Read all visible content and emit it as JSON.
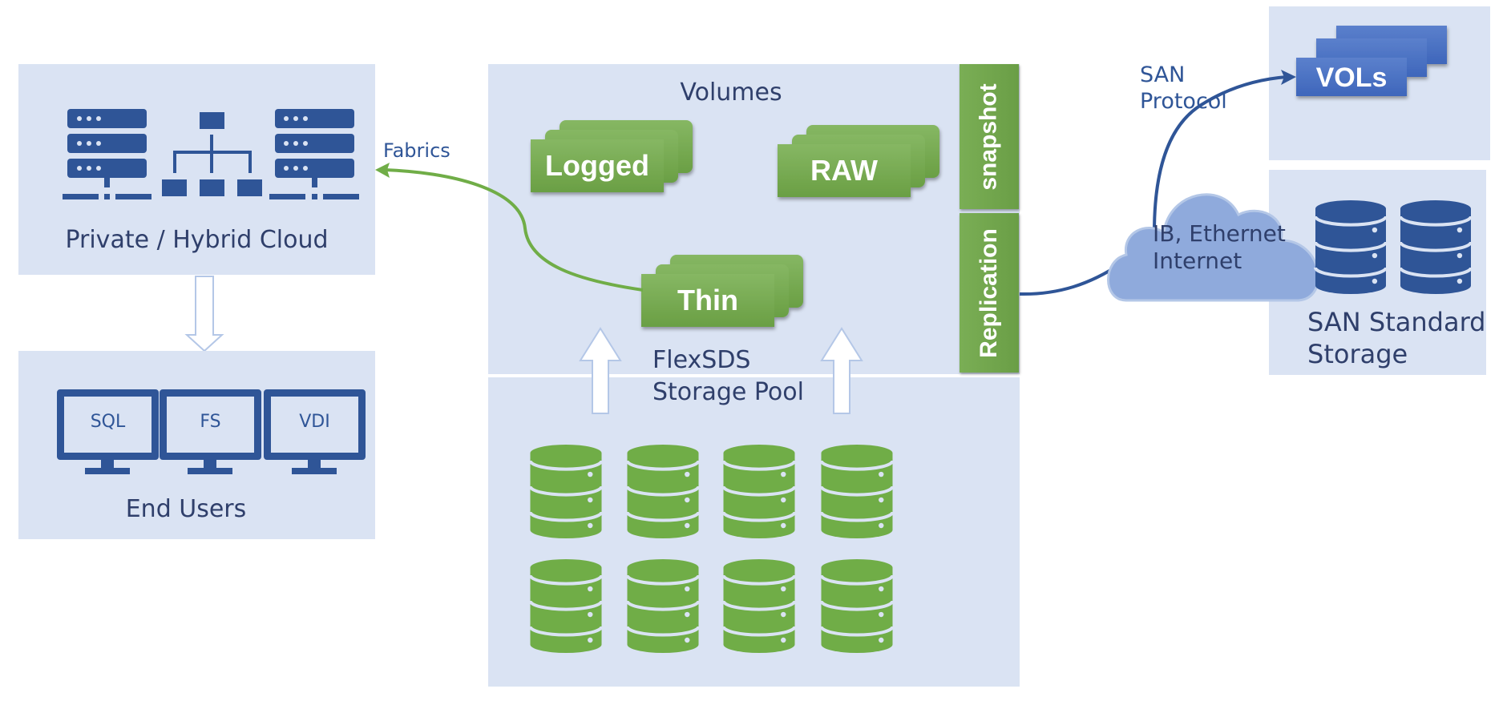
{
  "private_cloud": {
    "label": "Private / Hybrid Cloud",
    "icons": [
      "server-rack-icon",
      "network-topology-icon",
      "server-rack-icon"
    ]
  },
  "end_users": {
    "label": "End Users",
    "monitors": [
      {
        "label": "SQL"
      },
      {
        "label": "FS"
      },
      {
        "label": "VDI"
      }
    ]
  },
  "fabrics": {
    "label": "Fabrics"
  },
  "volumes": {
    "title": "Volumes",
    "types": [
      {
        "label": "Logged"
      },
      {
        "label": "RAW"
      },
      {
        "label": "Thin"
      }
    ],
    "services": [
      {
        "label": "snapshot"
      },
      {
        "label": "Replication"
      }
    ]
  },
  "storage_pool": {
    "line1": "FlexSDS",
    "line2": "Storage Pool",
    "disk_count": 8
  },
  "network": {
    "line1": "IB, Ethernet",
    "line2": "Internet"
  },
  "san_protocol": {
    "line1": "SAN",
    "line2": "Protocol"
  },
  "vols": {
    "label": "VOLs"
  },
  "san_storage": {
    "line1": "SAN Standard",
    "line2": "Storage",
    "disk_count": 2
  },
  "colors": {
    "panel": "#dae3f3",
    "navy": "#2f5597",
    "green": "#70ad47",
    "cloud": "#8faadc",
    "vols": "#4472c4",
    "text": "#2f3f6b"
  }
}
